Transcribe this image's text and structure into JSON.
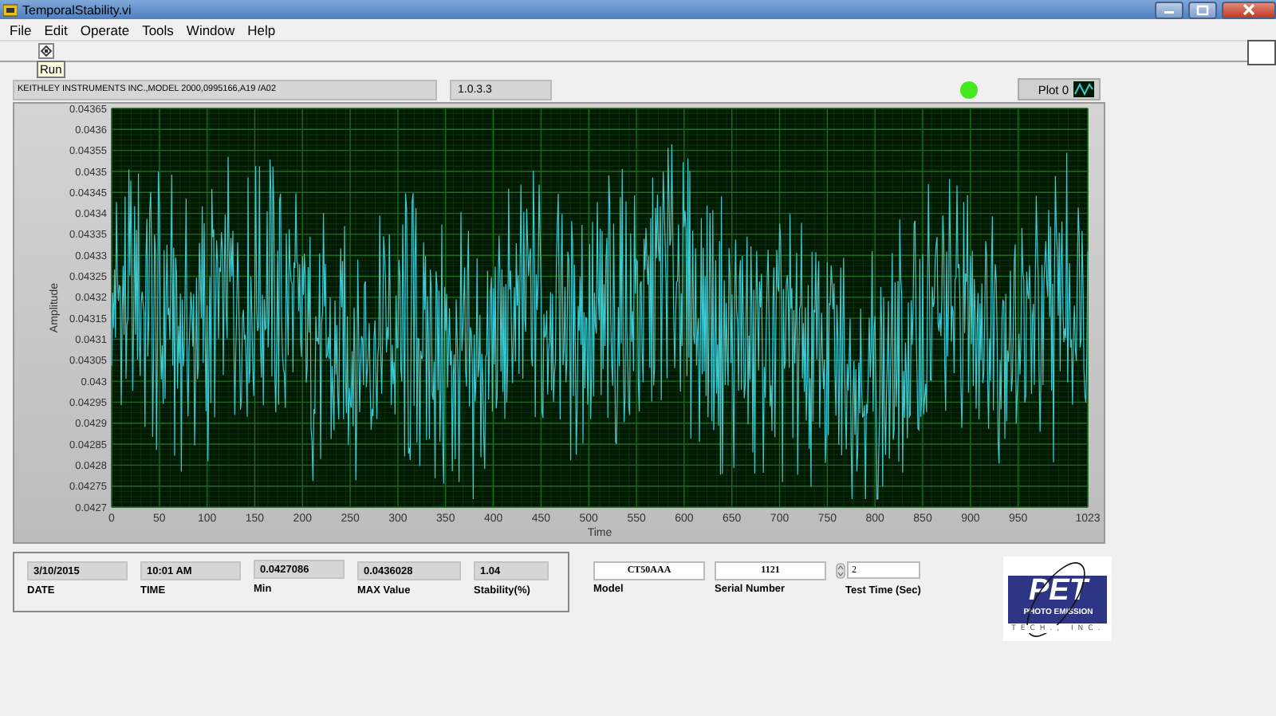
{
  "window": {
    "title": "TemporalStability.vi"
  },
  "menu": [
    "File",
    "Edit",
    "Operate",
    "Tools",
    "Window",
    "Help"
  ],
  "toolbar": {
    "tooltip": "Run"
  },
  "instrument": {
    "id": "KEITHLEY INSTRUMENTS INC.,MODEL 2000,0995166,A19  /A02",
    "version": "1.0.3.3"
  },
  "led": {
    "on": true
  },
  "legend": {
    "label": "Plot 0"
  },
  "chart": {
    "y_label": "Amplitude",
    "x_label": "Time",
    "y_ticks": [
      "0.04365",
      "0.0436",
      "0.04355",
      "0.0435",
      "0.04345",
      "0.0434",
      "0.04335",
      "0.0433",
      "0.04325",
      "0.0432",
      "0.04315",
      "0.0431",
      "0.04305",
      "0.043",
      "0.04295",
      "0.0429",
      "0.04285",
      "0.0428",
      "0.04275",
      "0.0427"
    ],
    "x_ticks": [
      "0",
      "50",
      "100",
      "150",
      "200",
      "250",
      "300",
      "350",
      "400",
      "450",
      "500",
      "550",
      "600",
      "650",
      "700",
      "750",
      "800",
      "850",
      "900",
      "950",
      "1023"
    ]
  },
  "results": [
    {
      "label": "DATE",
      "value": "3/10/2015"
    },
    {
      "label": "TIME",
      "value": "10:01 AM"
    },
    {
      "label": "Min",
      "value": "0.0427086"
    },
    {
      "label": "MAX Value",
      "value": "0.0436028"
    },
    {
      "label": "Stability(%)",
      "value": "1.04"
    }
  ],
  "settings": [
    {
      "kind": "text",
      "label": "Model",
      "value": "CT50AAA"
    },
    {
      "kind": "text",
      "label": "Serial Number",
      "value": "1121"
    },
    {
      "kind": "numeric",
      "label": "Test Time (Sec)",
      "value": "2"
    }
  ],
  "logo": {
    "mark": "PET",
    "name": "PHOTO EMISSION",
    "sub": "TECH., INC."
  }
}
